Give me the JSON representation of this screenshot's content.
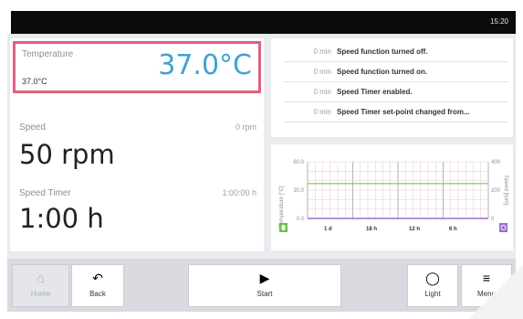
{
  "status_bar": {
    "time": "15:20"
  },
  "temperature": {
    "label": "Temperature",
    "value": "37.0°C",
    "setpoint": "37.0°C"
  },
  "speed": {
    "label": "Speed",
    "current": "0 rpm",
    "value": "50 rpm"
  },
  "speed_timer": {
    "label": "Speed Timer",
    "current": "1:00:00 h",
    "value": "1:00 h"
  },
  "log": [
    {
      "time": "0 min",
      "message": "Speed function turned off."
    },
    {
      "time": "0 min",
      "message": "Speed function turned on."
    },
    {
      "time": "0 min",
      "message": "Speed Timer enabled."
    },
    {
      "time": "0 min",
      "message": "Speed Timer set-point changed from..."
    }
  ],
  "chart_data": {
    "type": "line",
    "ylabel_left": "Temperature [°C]",
    "ylabel_right": "Speed [rpm]",
    "y_left_ticks": [
      "60.0",
      "30.0",
      "0.0"
    ],
    "y_right_ticks": [
      "400",
      "200",
      "0"
    ],
    "ylim_left": [
      0,
      60
    ],
    "ylim_right": [
      0,
      400
    ],
    "x_ticks": [
      "1 d",
      "18 h",
      "12 h",
      "6 h"
    ],
    "grid": true,
    "colors": {
      "temperature": "#8fd16a",
      "speed": "#9b6fc8"
    },
    "series": [
      {
        "axis": "left",
        "values": [
          37,
          37,
          37,
          37,
          37
        ]
      },
      {
        "axis": "right",
        "values": [
          0,
          0,
          0,
          0,
          0
        ]
      }
    ]
  },
  "toolbar": {
    "home_label": "Home",
    "back_label": "Back",
    "start_label": "Start",
    "light_label": "Light",
    "menu_label": "Menu"
  }
}
